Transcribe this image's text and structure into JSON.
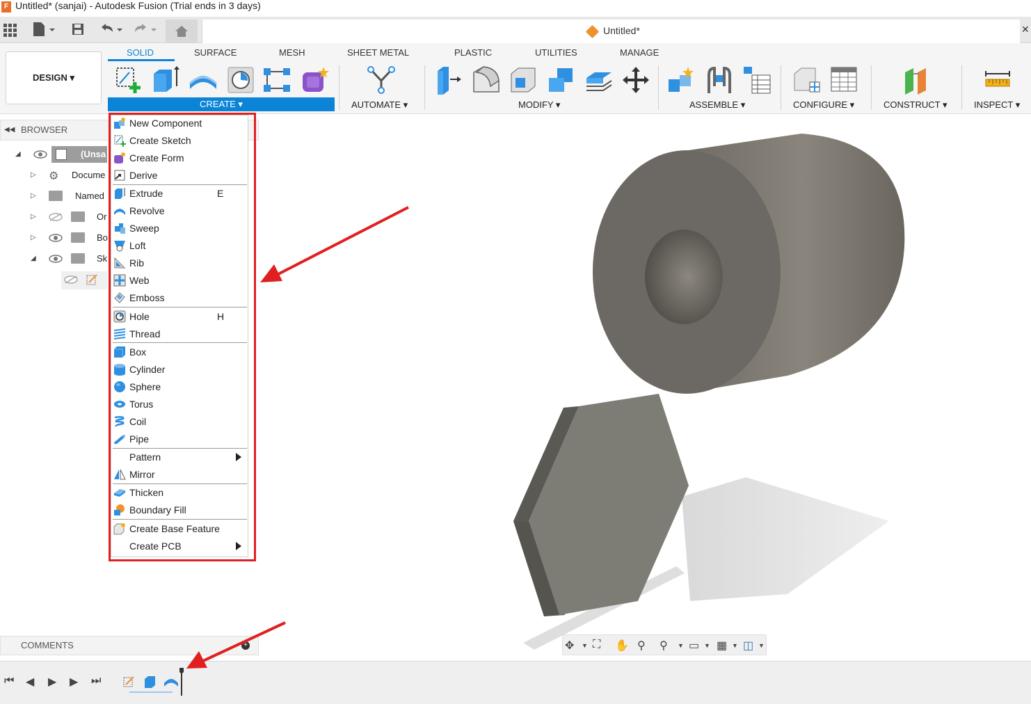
{
  "window": {
    "title": "Untitled* (sanjai) - Autodesk Fusion (Trial ends in 3 days)",
    "logo_letter": "F"
  },
  "document": {
    "title": "Untitled*"
  },
  "workspace": {
    "label": "DESIGN ▾"
  },
  "ribbon": {
    "tabs": [
      "SOLID",
      "SURFACE",
      "MESH",
      "SHEET METAL",
      "PLASTIC",
      "UTILITIES",
      "MANAGE"
    ],
    "groups": [
      "CREATE ▾",
      "AUTOMATE ▾",
      "MODIFY ▾",
      "ASSEMBLE ▾",
      "CONFIGURE ▾",
      "CONSTRUCT ▾",
      "INSPECT ▾"
    ]
  },
  "browser": {
    "title": "BROWSER",
    "items": [
      "(Unsa",
      "Docume",
      "Named",
      "Or",
      "Bo",
      "Sk"
    ]
  },
  "comments": {
    "label": "COMMENTS"
  },
  "create_menu": {
    "items": [
      {
        "label": "New Component",
        "key": ""
      },
      {
        "label": "Create Sketch",
        "key": ""
      },
      {
        "label": "Create Form",
        "key": ""
      },
      {
        "label": "Derive",
        "key": ""
      },
      {
        "label": "Extrude",
        "key": "E"
      },
      {
        "label": "Revolve",
        "key": ""
      },
      {
        "label": "Sweep",
        "key": ""
      },
      {
        "label": "Loft",
        "key": ""
      },
      {
        "label": "Rib",
        "key": ""
      },
      {
        "label": "Web",
        "key": ""
      },
      {
        "label": "Emboss",
        "key": ""
      },
      {
        "label": "Hole",
        "key": "H"
      },
      {
        "label": "Thread",
        "key": ""
      },
      {
        "label": "Box",
        "key": ""
      },
      {
        "label": "Cylinder",
        "key": ""
      },
      {
        "label": "Sphere",
        "key": ""
      },
      {
        "label": "Torus",
        "key": ""
      },
      {
        "label": "Coil",
        "key": ""
      },
      {
        "label": "Pipe",
        "key": ""
      },
      {
        "label": "Pattern",
        "key": ""
      },
      {
        "label": "Mirror",
        "key": ""
      },
      {
        "label": "Thicken",
        "key": ""
      },
      {
        "label": "Boundary Fill",
        "key": ""
      },
      {
        "label": "Create Base Feature",
        "key": ""
      },
      {
        "label": "Create PCB",
        "key": ""
      }
    ]
  },
  "colors": {
    "accent": "#0b84d8",
    "highlight_frame": "#e02020",
    "annotation_arrow": "#e02020"
  }
}
